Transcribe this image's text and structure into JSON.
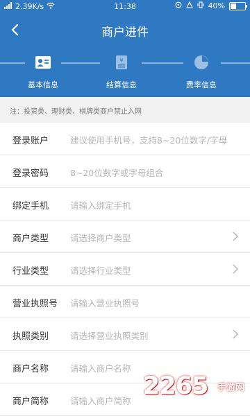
{
  "status_bar": {
    "signal": "4G",
    "speed": "2.39K/s",
    "time": "11:38",
    "battery": "40%"
  },
  "nav": {
    "title": "商户进件"
  },
  "steps": [
    {
      "label": "基本信息",
      "icon": "id-card-icon",
      "active": true
    },
    {
      "label": "结算信息",
      "icon": "yen-document-icon",
      "active": false
    },
    {
      "label": "费率信息",
      "icon": "pie-chart-icon",
      "active": false
    }
  ],
  "notice": "注：投资类、理财类、棋牌类商户禁止入网",
  "fields": [
    {
      "label": "登录账户",
      "placeholder": "建议使用手机号，支持8~20位数字/字母",
      "arrow": false
    },
    {
      "label": "登录密码",
      "placeholder": "8~20位数字或字母组合",
      "arrow": false
    },
    {
      "label": "绑定手机",
      "placeholder": "请输入绑定手机",
      "arrow": false
    },
    {
      "label": "商户类型",
      "placeholder": "请选择商户类型",
      "arrow": true
    },
    {
      "label": "行业类型",
      "placeholder": "请选择行业类型",
      "arrow": true
    },
    {
      "label": "营业执照号",
      "placeholder": "请输入营业执照号",
      "arrow": false
    },
    {
      "label": "执照类别",
      "placeholder": "请选择营业执照类别",
      "arrow": true
    },
    {
      "label": "商户名称",
      "placeholder": "请输入商户名称",
      "arrow": false
    },
    {
      "label": "商户简称",
      "placeholder": "请输入商户简称",
      "arrow": false
    }
  ],
  "watermark": {
    "number": "2265",
    "suffix": "手游网"
  },
  "colors": {
    "header": "#2f79c2",
    "line": "#8fb5dd",
    "placeholder": "#b7b7b7"
  }
}
